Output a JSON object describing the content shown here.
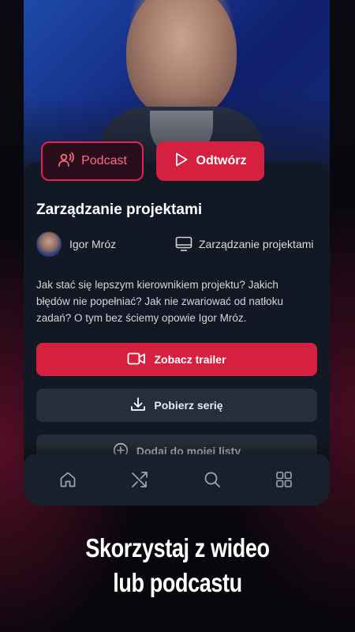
{
  "actions": {
    "podcast_label": "Podcast",
    "play_label": "Odtwórz"
  },
  "course": {
    "title": "Zarządzanie projektami",
    "author": "Igor Mróz",
    "category": "Zarządzanie projektami",
    "description": "Jak stać się lepszym kierownikiem projektu? Jakich błędów nie popełniać? Jak nie zwariować od natłoku zadań? O tym bez ściemy opowie Igor Mróz."
  },
  "buttons": {
    "trailer_label": "Zobacz trailer",
    "download_label": "Pobierz serię",
    "add_list_label": "Dodaj do mojej listy"
  },
  "nav": {
    "items": [
      {
        "icon": "home-icon"
      },
      {
        "icon": "shuffle-icon"
      },
      {
        "icon": "search-icon"
      },
      {
        "icon": "grid-icon"
      }
    ]
  },
  "promo": {
    "line1": "Skorzystaj z wideo",
    "line2": "lub podcastu"
  },
  "colors": {
    "accent": "#d5203f",
    "background": "#121824",
    "secondary_button": "#262e3b"
  }
}
